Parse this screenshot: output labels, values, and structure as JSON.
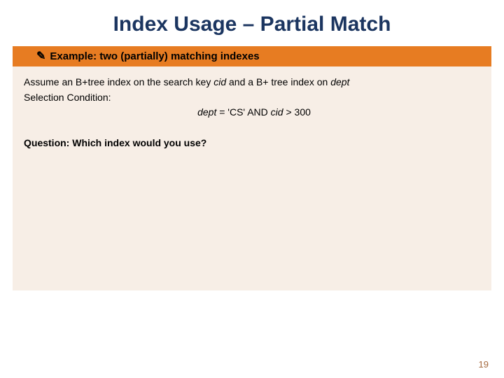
{
  "title": "Index Usage – Partial Match",
  "banner": {
    "icon": "✎",
    "text": "Example: two (partially) matching indexes"
  },
  "body": {
    "assume_pre": "Assume an B+tree index on the search key ",
    "cid": "cid",
    "assume_mid": " and a B+ tree index on ",
    "dept": "dept",
    "selcond_label": "Selection Condition:",
    "formula_dept": "dept",
    "formula_eq1": " = 'CS' AND ",
    "formula_cid": "cid",
    "formula_eq2": " > 300",
    "question_label": "Question:",
    "question_text": " Which index would you use?"
  },
  "pagenum": "19"
}
